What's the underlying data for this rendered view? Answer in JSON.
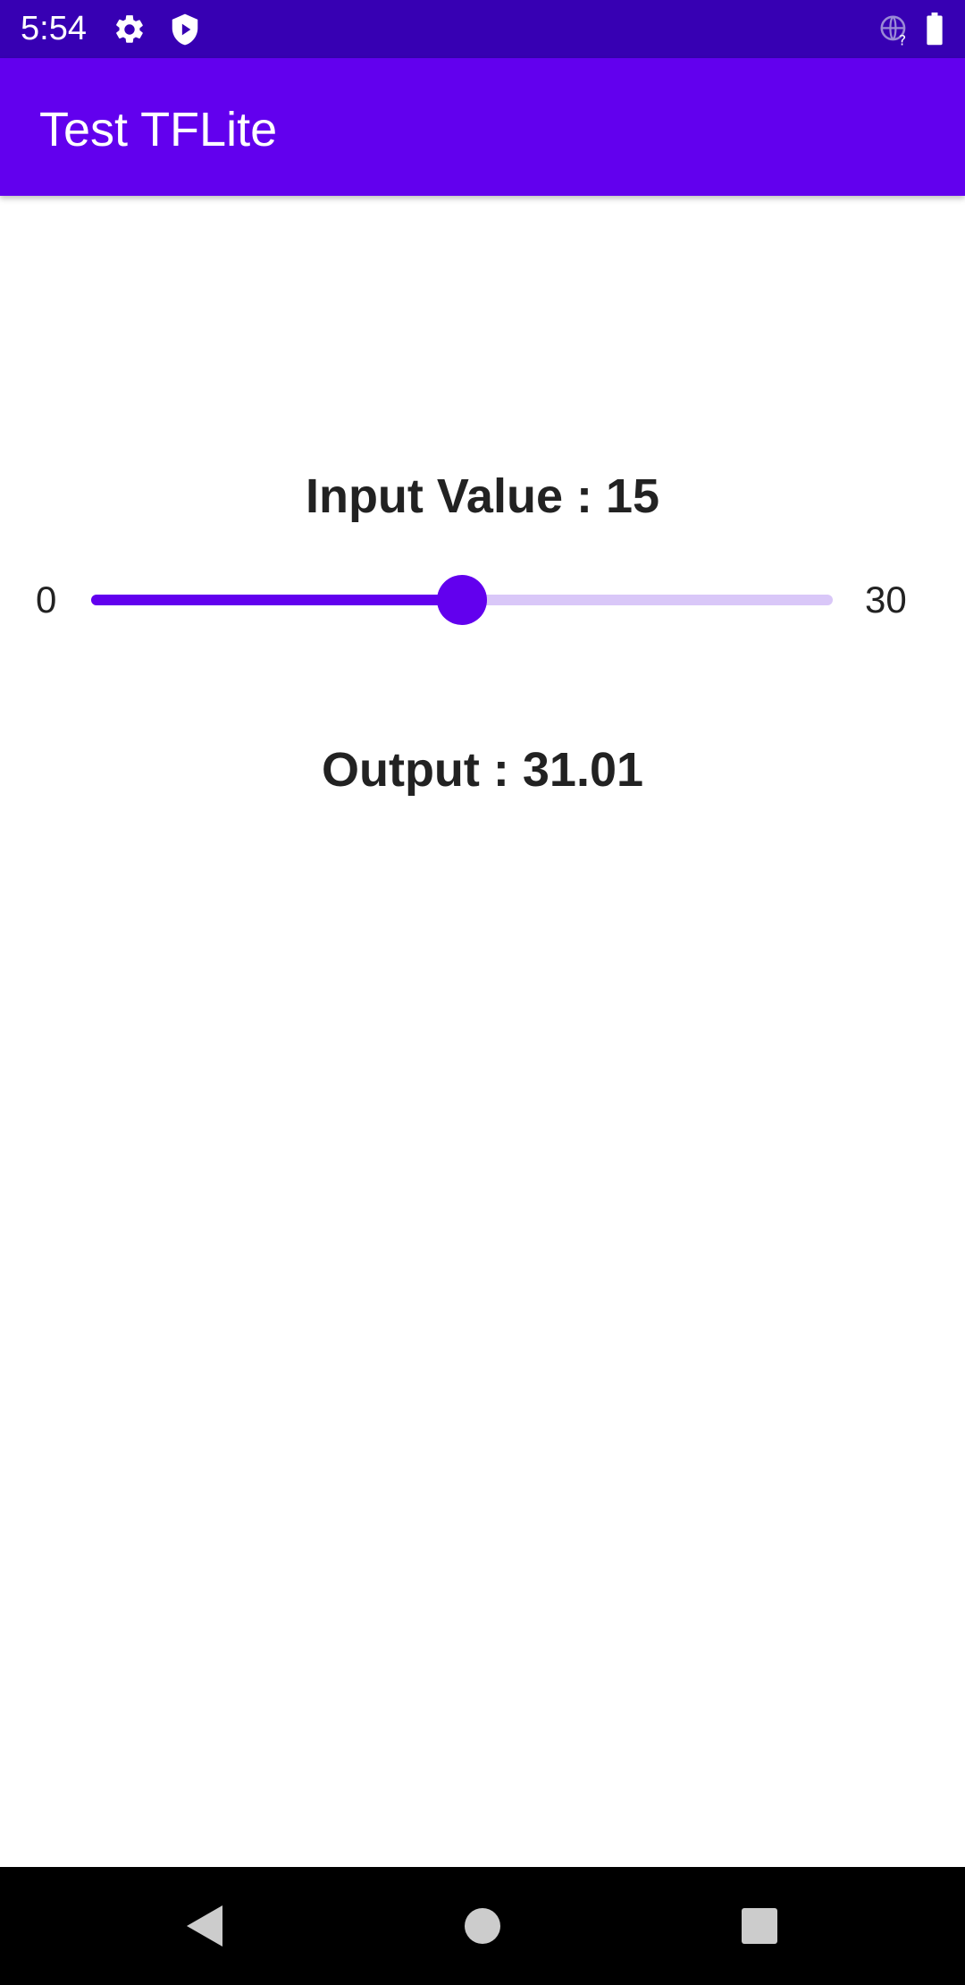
{
  "status_bar": {
    "time": "5:54",
    "icons": [
      "gear-icon",
      "shield-play-icon",
      "globe-question-icon",
      "battery-icon"
    ],
    "background": "#3700b3"
  },
  "app_bar": {
    "title": "Test TFLite",
    "background": "#6200ee"
  },
  "main": {
    "input_label": "Input Value : 15",
    "slider": {
      "min_label": "0",
      "max_label": "30",
      "min": 0,
      "max": 30,
      "value": 15,
      "accent": "#6200ee",
      "track_inactive": "#d9c7f8"
    },
    "output_label": "Output : 31.01"
  },
  "nav_bar": {
    "buttons": [
      "back-icon",
      "home-icon",
      "recents-icon"
    ]
  }
}
